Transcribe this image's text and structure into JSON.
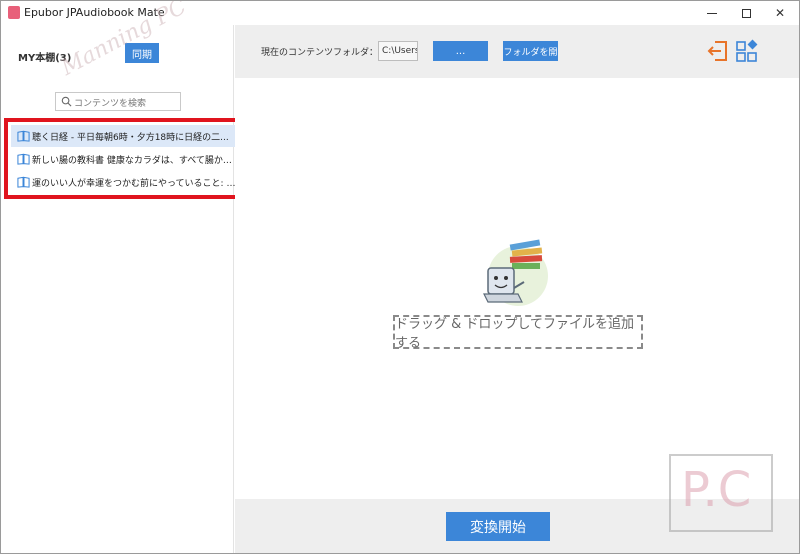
{
  "window": {
    "title": "Epubor JPAudiobook Mate"
  },
  "sidebar": {
    "shelf_label": "MY本棚(3)",
    "sync_label": "同期",
    "search_placeholder": "コンテンツを検索",
    "books": [
      {
        "title": "聴く日経 - 平日毎朝6時・夕方18時に日経の二..."
      },
      {
        "title": "新しい腸の教科書 健康なカラダは、すべて腸から..."
      },
      {
        "title": "運のいい人が幸運をつかむ前にやっていること: セレ..."
      }
    ]
  },
  "toolbar": {
    "folder_label": "現在のコンテンツフォルダ：",
    "folder_path": "C:\\Users\\",
    "browse_label": "...",
    "open_folder_label": "フォルダを開"
  },
  "main": {
    "drop_hint": "ドラッグ & ドロップしてファイルを追加する"
  },
  "bottom": {
    "convert_label": "変換開始"
  },
  "watermark": {
    "text": "Manning PC",
    "logo": "P.C"
  },
  "colors": {
    "accent": "#3c86d8",
    "highlight": "#e0141e",
    "icon_orange": "#e8742a"
  }
}
